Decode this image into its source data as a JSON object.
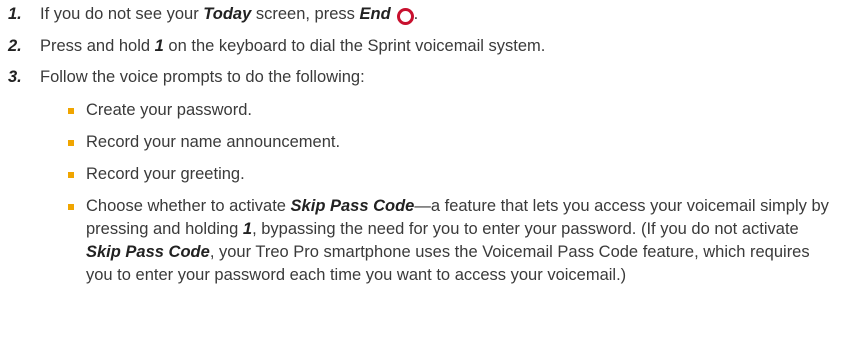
{
  "steps": [
    {
      "number": "1.",
      "text_before": "If you do not see your ",
      "em1": "Today",
      "text_mid": " screen, press ",
      "em2": "End",
      "icon": "end-key-icon",
      "text_after": "."
    },
    {
      "number": "2.",
      "text_before": "Press and hold ",
      "em1": "1",
      "text_after": " on the keyboard to dial the Sprint voicemail system."
    },
    {
      "number": "3.",
      "text": "Follow the voice prompts to do the following:"
    }
  ],
  "sub_items": [
    {
      "text": "Create your password."
    },
    {
      "text": "Record your name announcement."
    },
    {
      "text": "Record your greeting."
    }
  ],
  "skip_item": {
    "p1": "Choose whether to activate ",
    "em1": "Skip Pass Code",
    "p2": "—a feature that lets you access your voicemail simply by pressing and holding ",
    "em2": "1",
    "p3": ", bypassing the need for you to enter your password. (If you do not activate ",
    "em3": "Skip Pass Code",
    "p4": ", your Treo Pro smartphone uses the Voicemail Pass Code feature, which requires you to enter your password each time you want to access your voicemail.)"
  },
  "colors": {
    "bullet": "#f0a500",
    "end_key": "#c8102e"
  }
}
